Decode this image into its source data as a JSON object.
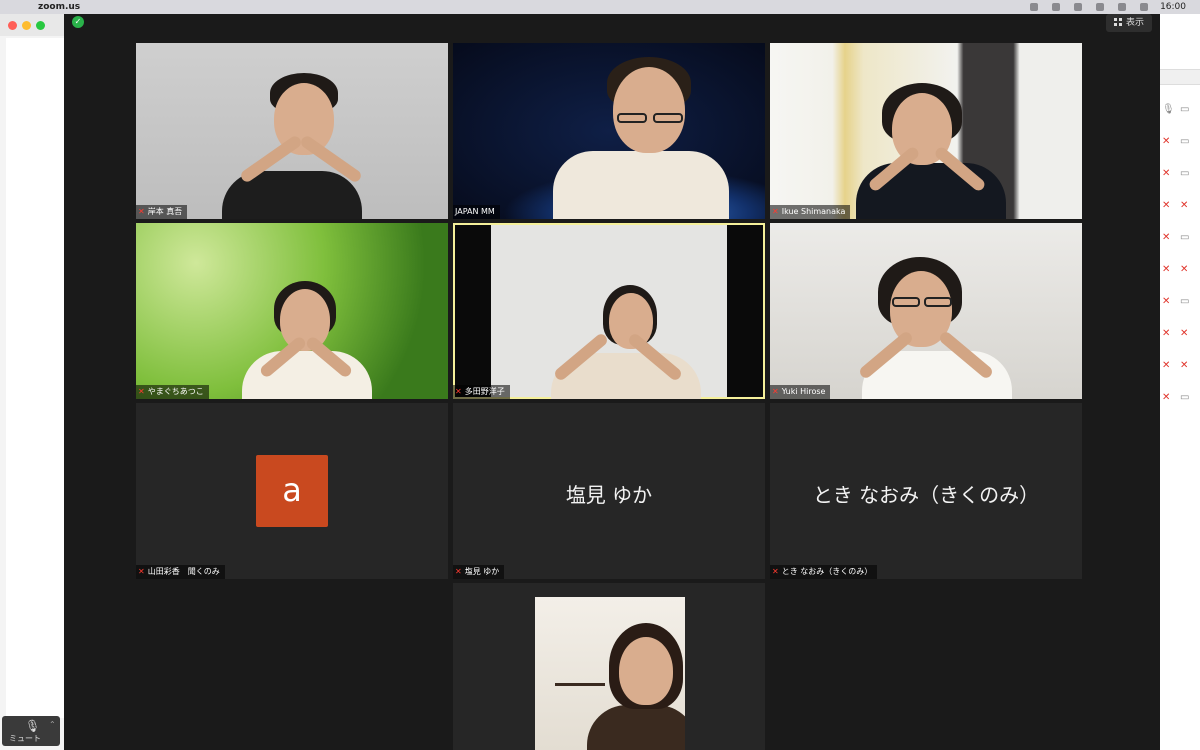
{
  "menubar": {
    "apple_icon": "apple-icon",
    "app_name": "zoom.us",
    "clock": "16:00"
  },
  "toolbar": {
    "view_label": "表示",
    "mute_label": "ミュート"
  },
  "colors": {
    "active_speaker_border": "#f5f09a",
    "muted_red": "#ff3b30",
    "avatar_bg": "#c9491f",
    "tile_bg": "#262626"
  },
  "tiles": [
    {
      "name": "岸本 真吾",
      "muted": true,
      "video": true
    },
    {
      "name": "JAPAN MM",
      "muted": false,
      "video": true
    },
    {
      "name": "Ikue Shimanaka",
      "muted": true,
      "video": true
    },
    {
      "name": "やまぐちあつこ",
      "muted": true,
      "video": true
    },
    {
      "name": "多田野洋子",
      "muted": true,
      "video": true,
      "active": true
    },
    {
      "name": "Yuki Hirose",
      "muted": true,
      "video": true
    },
    {
      "name": "山田彩香　聞くのみ",
      "muted": true,
      "video": false,
      "avatar_letter": "a"
    },
    {
      "name": "塩見 ゆか",
      "muted": true,
      "video": false,
      "display_name": "塩見 ゆか"
    },
    {
      "name": "とき なおみ（きくのみ）",
      "muted": true,
      "video": false,
      "display_name": "とき なおみ（きくのみ）"
    },
    {
      "video": true
    }
  ]
}
